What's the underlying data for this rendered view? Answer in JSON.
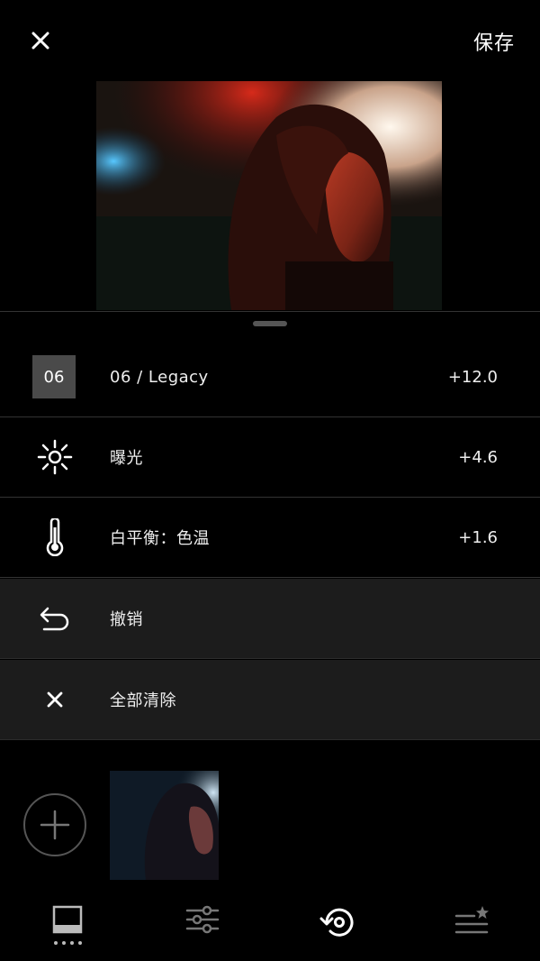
{
  "header": {
    "close_icon": "close-icon",
    "save_label": "保存"
  },
  "adjustments": [
    {
      "icon": "preset-badge",
      "badge": "06",
      "label": "06 / Legacy",
      "value": "+12.0"
    },
    {
      "icon": "sun-icon",
      "label": "曝光",
      "value": "+4.6"
    },
    {
      "icon": "thermometer-icon",
      "label": "白平衡：色温",
      "value": "+1.6"
    }
  ],
  "actions": [
    {
      "icon": "undo-icon",
      "label": "撤销"
    },
    {
      "icon": "close-icon",
      "label": "全部清除"
    }
  ],
  "history": {
    "add_icon": "plus-circle-icon"
  },
  "toolbar": {
    "items": [
      {
        "icon": "presets-icon",
        "active": true
      },
      {
        "icon": "sliders-icon"
      },
      {
        "icon": "history-icon"
      },
      {
        "icon": "recipes-icon"
      }
    ]
  },
  "colors": {
    "background": "#000000",
    "row_gray": "#1c1c1c",
    "badge_gray": "#4a4a4a",
    "divider": "#333333"
  }
}
